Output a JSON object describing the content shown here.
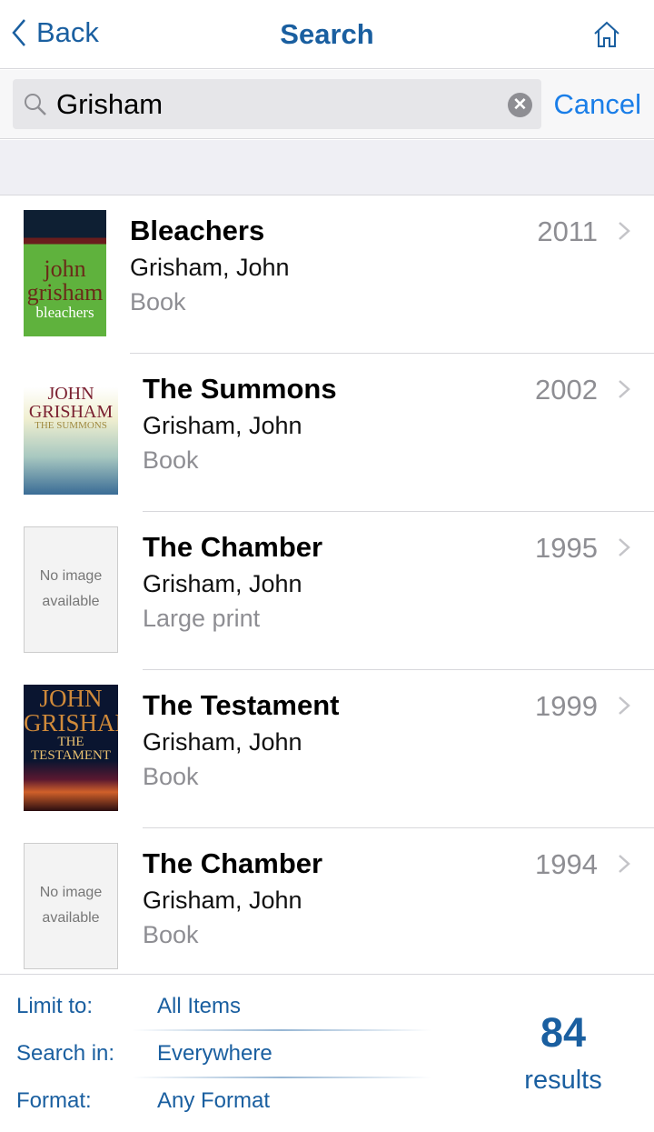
{
  "nav": {
    "back_label": "Back",
    "title": "Search",
    "home_icon": "home-icon"
  },
  "search": {
    "value": "Grisham",
    "cancel_label": "Cancel",
    "clear_icon": "clear-icon"
  },
  "results": [
    {
      "title": "Bleachers",
      "author": "Grisham, John",
      "format": "Book",
      "year": "2011",
      "cover": {
        "type": "bleachers",
        "lines": [
          "john",
          "grisham",
          "bleachers"
        ]
      }
    },
    {
      "title": "The Summons",
      "author": "Grisham, John",
      "format": "Book",
      "year": "2002",
      "cover": {
        "type": "summons",
        "lines": [
          "JOHN",
          "GRISHAM",
          "THE SUMMONS"
        ]
      }
    },
    {
      "title": "The Chamber",
      "author": "Grisham, John",
      "format": "Large print",
      "year": "1995",
      "cover": {
        "type": "none",
        "lines": [
          "No image",
          "available"
        ]
      }
    },
    {
      "title": "The Testament",
      "author": "Grisham, John",
      "format": "Book",
      "year": "1999",
      "cover": {
        "type": "testament",
        "lines": [
          "JOHN",
          "GRISHAM",
          "THE TESTAMENT"
        ]
      }
    },
    {
      "title": "The Chamber",
      "author": "Grisham, John",
      "format": "Book",
      "year": "1994",
      "cover": {
        "type": "none",
        "lines": [
          "No image",
          "available"
        ]
      }
    }
  ],
  "filters": [
    {
      "label": "Limit to:",
      "value": "All Items"
    },
    {
      "label": "Search in:",
      "value": "Everywhere"
    },
    {
      "label": "Format:",
      "value": "Any Format"
    }
  ],
  "summary": {
    "count": "84",
    "label": "results"
  },
  "colors": {
    "accent": "#1a5fa0",
    "link": "#1a7ee8",
    "secondary": "#8e8e93"
  }
}
